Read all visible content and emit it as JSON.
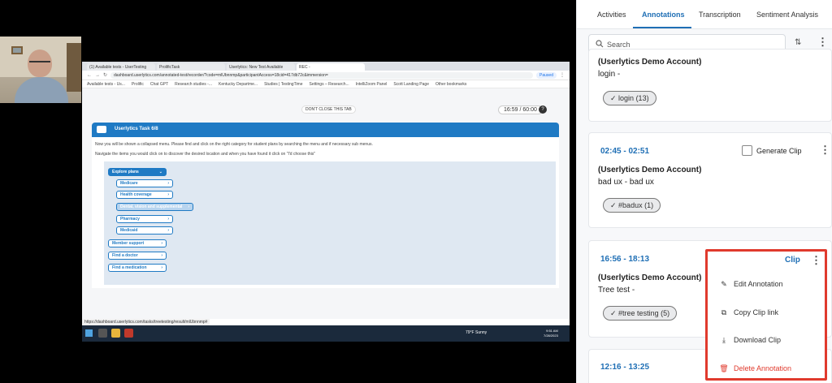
{
  "screen": {
    "tabs": [
      "(1) Available tests - UserTesting",
      "ProlificTask",
      "Userlytics: New Test Available",
      "REC -"
    ],
    "url": "dashboard.userlytics.com/annotated-test/recorder/?code=mlUbnnmp&participantAccess=18cid=417db72c&immersion=",
    "paused_label": "Paused",
    "bookmarks": [
      "Available tests - Us...",
      "Prolific",
      "Chat GPT",
      "Research studies -...",
      "Kentucky Departme...",
      "Studies | TestingTime",
      "Settings – Research...",
      "IntelliZoom Panel",
      "Scott Landing Page",
      "Other bookmarks"
    ],
    "dont_close": "DON'T CLOSE THIS TAB",
    "timer": "16:59 / 60:00",
    "help": "?",
    "task_title": "Userlytics Task 6/8",
    "instruction_1": "Now you will be shown a collapsed menu. Please find and click on the right category for student plans by searching the menu and if necessary sub menus.",
    "instruction_2": "Navigate the items you would click on to discover the desired location and when you have found it click on \"I'd choose this\"",
    "tree": {
      "root": "Explore plans",
      "items": [
        "Medicare",
        "Health coverage",
        "Dental, vision and supplemental",
        "Pharmacy",
        "Medicaid",
        "Member support",
        "Find a doctor",
        "Find a medication"
      ]
    },
    "status_url": "https://dashboard.userlytics.com/tasks/treetesting/result/mlUbnnmp#",
    "weather": "79°F Sunny",
    "time": "9:51 AM",
    "date": "7/28/2023"
  },
  "panel": {
    "tabs": [
      "Activities",
      "Annotations",
      "Transcription",
      "Sentiment Analysis"
    ],
    "active_tab": "Annotations",
    "search_placeholder": "Search",
    "sort_icon": "sort-icon",
    "cards": [
      {
        "account": "(Userlytics Demo Account)",
        "note": "login -",
        "tag": "login (13)"
      },
      {
        "time": "02:45 - 02:51",
        "generate_clip": "Generate Clip",
        "account": "(Userlytics Demo Account)",
        "note": "bad ux - bad ux",
        "tag": "#badux (1)"
      },
      {
        "time": "16:56 - 18:13",
        "clip": "Clip",
        "account": "(Userlytics Demo Account)",
        "note": "Tree test -",
        "tag": "#tree testing (5)"
      },
      {
        "time": "12:16 - 13:25"
      }
    ],
    "menu": {
      "clip": "Clip",
      "items": [
        {
          "label": "Edit Annotation",
          "icon": "pencil-icon"
        },
        {
          "label": "Copy Clip link",
          "icon": "copy-icon"
        },
        {
          "label": "Download Clip",
          "icon": "download-icon"
        },
        {
          "label": "Delete Annotation",
          "icon": "trash-icon"
        }
      ]
    },
    "colors": {
      "accent": "#1f6fb5",
      "danger": "#e03a2d",
      "highlight_border": "#e03a2d"
    }
  }
}
